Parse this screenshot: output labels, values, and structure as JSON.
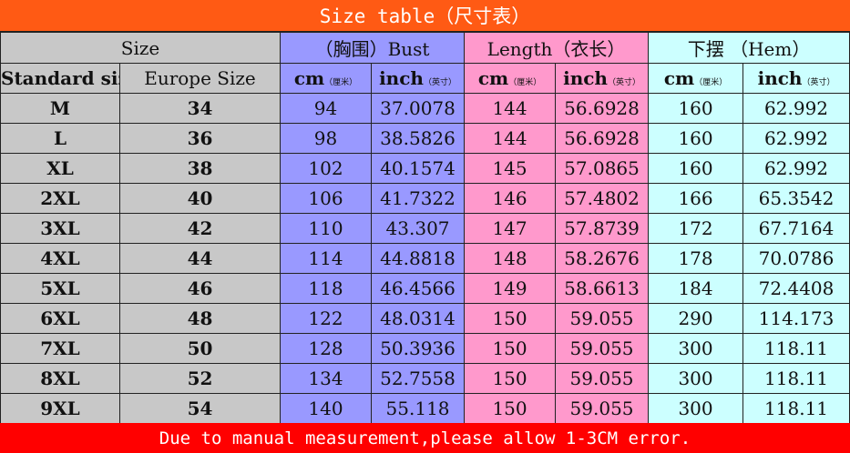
{
  "title": "Size table（尺寸表）",
  "groups": {
    "size": "Size",
    "bust": "（胸围）Bust",
    "length": "Length（衣长）",
    "hem": "下摆  （Hem）"
  },
  "subheaders": {
    "standard_size": "Standard size",
    "europe_size": "Europe Size",
    "cm": "cm",
    "cm_cn": "（厘米）",
    "inch": "inch",
    "inch_cn": "（英寸）"
  },
  "rows": [
    {
      "size": "M",
      "eu": "34",
      "bust_cm": "94",
      "bust_in": "37.0078",
      "len_cm": "144",
      "len_in": "56.6928",
      "hem_cm": "160",
      "hem_in": "62.992"
    },
    {
      "size": "L",
      "eu": "36",
      "bust_cm": "98",
      "bust_in": "38.5826",
      "len_cm": "144",
      "len_in": "56.6928",
      "hem_cm": "160",
      "hem_in": "62.992"
    },
    {
      "size": "XL",
      "eu": "38",
      "bust_cm": "102",
      "bust_in": "40.1574",
      "len_cm": "145",
      "len_in": "57.0865",
      "hem_cm": "160",
      "hem_in": "62.992"
    },
    {
      "size": "2XL",
      "eu": "40",
      "bust_cm": "106",
      "bust_in": "41.7322",
      "len_cm": "146",
      "len_in": "57.4802",
      "hem_cm": "166",
      "hem_in": "65.3542"
    },
    {
      "size": "3XL",
      "eu": "42",
      "bust_cm": "110",
      "bust_in": "43.307",
      "len_cm": "147",
      "len_in": "57.8739",
      "hem_cm": "172",
      "hem_in": "67.7164"
    },
    {
      "size": "4XL",
      "eu": "44",
      "bust_cm": "114",
      "bust_in": "44.8818",
      "len_cm": "148",
      "len_in": "58.2676",
      "hem_cm": "178",
      "hem_in": "70.0786"
    },
    {
      "size": "5XL",
      "eu": "46",
      "bust_cm": "118",
      "bust_in": "46.4566",
      "len_cm": "149",
      "len_in": "58.6613",
      "hem_cm": "184",
      "hem_in": "72.4408"
    },
    {
      "size": "6XL",
      "eu": "48",
      "bust_cm": "122",
      "bust_in": "48.0314",
      "len_cm": "150",
      "len_in": "59.055",
      "hem_cm": "290",
      "hem_in": "114.173"
    },
    {
      "size": "7XL",
      "eu": "50",
      "bust_cm": "128",
      "bust_in": "50.3936",
      "len_cm": "150",
      "len_in": "59.055",
      "hem_cm": "300",
      "hem_in": "118.11"
    },
    {
      "size": "8XL",
      "eu": "52",
      "bust_cm": "134",
      "bust_in": "52.7558",
      "len_cm": "150",
      "len_in": "59.055",
      "hem_cm": "300",
      "hem_in": "118.11"
    },
    {
      "size": "9XL",
      "eu": "54",
      "bust_cm": "140",
      "bust_in": "55.118",
      "len_cm": "150",
      "len_in": "59.055",
      "hem_cm": "300",
      "hem_in": "118.11"
    }
  ],
  "footer": "Due to manual measurement,please allow 1-3CM error.",
  "colors": {
    "title_bg": "#ff5a14",
    "size_bg": "#c8c8c8",
    "bust_bg": "#9999ff",
    "length_bg": "#ff99cc",
    "hem_bg": "#ccffff",
    "footer_bg": "#ff0000",
    "standard_size_text": "#ff0000"
  }
}
